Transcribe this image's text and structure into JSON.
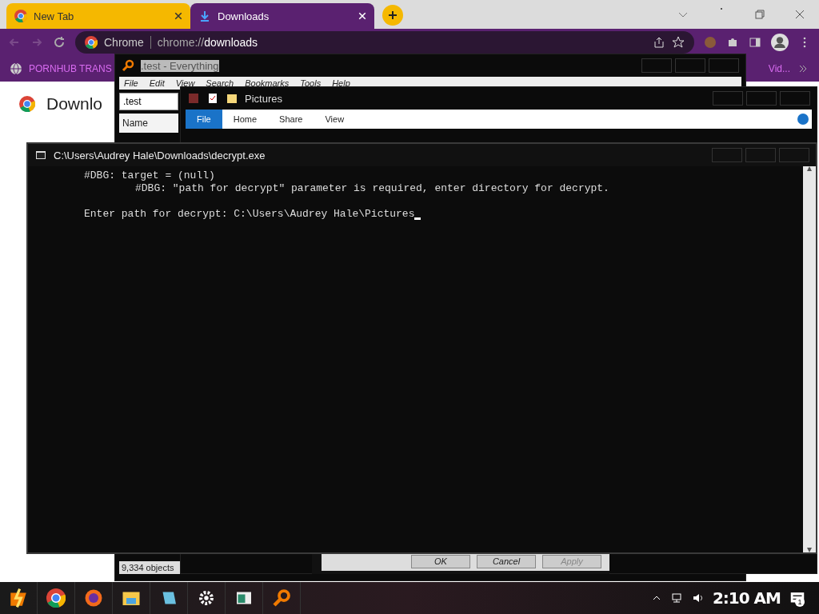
{
  "browser": {
    "tabs": [
      {
        "label": "New Tab",
        "selected": false
      },
      {
        "label": "Downloads",
        "selected": true
      }
    ],
    "address": {
      "site": "Chrome",
      "url_prefix": "chrome://",
      "url_page": "downloads"
    },
    "bookmarks": [
      {
        "label": "PORNHUB TRANS"
      },
      {
        "label": "Vid..."
      }
    ],
    "page_heading": "Downlo"
  },
  "everything_window": {
    "title": ".test - Everything",
    "menu": [
      "File",
      "Edit",
      "View",
      "Search",
      "Bookmarks",
      "Tools",
      "Help"
    ],
    "search": ".test",
    "column": "Name",
    "status": "9,334 objects"
  },
  "explorer_window": {
    "title": "Pictures",
    "ribbon_tabs": [
      {
        "label": "File",
        "selected": true
      },
      {
        "label": "Home",
        "selected": false
      },
      {
        "label": "Share",
        "selected": false
      },
      {
        "label": "View",
        "selected": false
      }
    ]
  },
  "dialog_buttons": [
    {
      "label": "OK",
      "disabled": false
    },
    {
      "label": "Cancel",
      "disabled": false
    },
    {
      "label": "Apply",
      "disabled": true
    }
  ],
  "console": {
    "title": "C:\\Users\\Audrey Hale\\Downloads\\decrypt.exe",
    "lines": [
      {
        "text": "#DBG: target = (null)",
        "kind": "plain"
      },
      {
        "text": "#DBG: \"path for decrypt\" parameter is required, enter directory for decrypt.",
        "kind": "indented"
      },
      {
        "kind": "blank"
      },
      {
        "text": "Enter path for decrypt: C:\\Users\\Audrey Hale\\Pictures",
        "kind": "prompt"
      }
    ]
  },
  "taskbar": {
    "clock": "2:10 AM",
    "notifications": "1"
  }
}
